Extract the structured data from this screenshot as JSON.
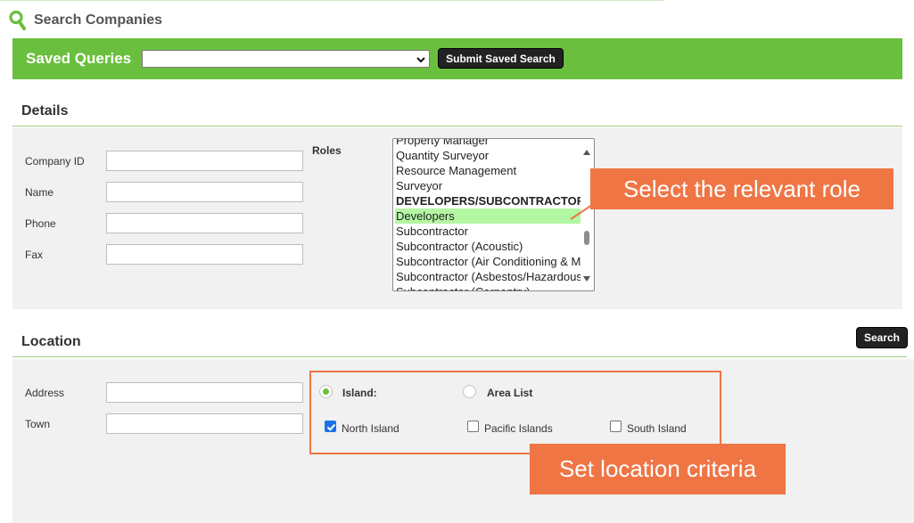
{
  "header": {
    "title": "Search Companies"
  },
  "saved_queries": {
    "label": "Saved Queries",
    "selected_value": "",
    "submit_label": "Submit Saved Search"
  },
  "details": {
    "heading": "Details",
    "fields": [
      {
        "label": "Company ID",
        "value": ""
      },
      {
        "label": "Name",
        "value": ""
      },
      {
        "label": "Phone",
        "value": ""
      },
      {
        "label": "Fax",
        "value": ""
      }
    ],
    "roles": {
      "label": "Roles",
      "items": [
        {
          "text": "Property Manager",
          "group": false,
          "selected": false
        },
        {
          "text": "Quantity Surveyor",
          "group": false,
          "selected": false
        },
        {
          "text": "Resource Management",
          "group": false,
          "selected": false
        },
        {
          "text": "Surveyor",
          "group": false,
          "selected": false
        },
        {
          "text": "DEVELOPERS/SUBCONTRACTORS",
          "group": true,
          "selected": false
        },
        {
          "text": "Developers",
          "group": false,
          "selected": true
        },
        {
          "text": "Subcontractor",
          "group": false,
          "selected": false
        },
        {
          "text": "Subcontractor (Acoustic)",
          "group": false,
          "selected": false
        },
        {
          "text": "Subcontractor (Air Conditioning & Mechanical)",
          "group": false,
          "selected": false
        },
        {
          "text": "Subcontractor (Asbestos/Hazardous)",
          "group": false,
          "selected": false
        },
        {
          "text": "Subcontractor (Carpentry)",
          "group": false,
          "selected": false
        }
      ]
    }
  },
  "location": {
    "heading": "Location",
    "search_label": "Search",
    "fields": [
      {
        "label": "Address",
        "value": ""
      },
      {
        "label": "Town",
        "value": ""
      }
    ],
    "mode_options": [
      {
        "label": "Island:",
        "selected": true
      },
      {
        "label": "Area List",
        "selected": false
      }
    ],
    "islands": [
      {
        "label": "North Island",
        "checked": true
      },
      {
        "label": "Pacific Islands",
        "checked": false
      },
      {
        "label": "South Island",
        "checked": false
      }
    ]
  },
  "annotations": {
    "role_callout": "Select the relevant role",
    "location_callout": "Set location criteria"
  },
  "colors": {
    "brand_green": "#6bbf3e",
    "callout_orange": "#ef7545",
    "selected_row": "#b3f7a3"
  }
}
